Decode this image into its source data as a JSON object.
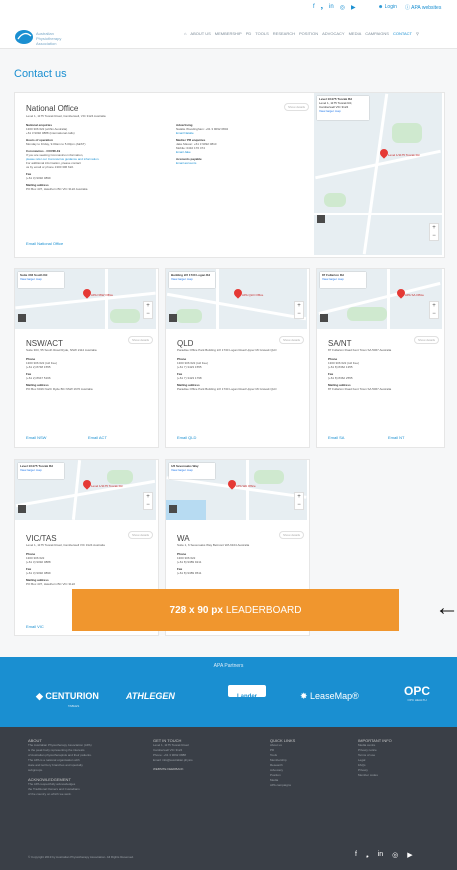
{
  "topbar": {
    "social": [
      "f",
      "❟",
      "in",
      "◎",
      "▶"
    ],
    "login": "Login",
    "apa_websites": "APA websites"
  },
  "logo": {
    "line1": "Australian",
    "line2": "Physiotherapy",
    "line3": "Association"
  },
  "nav": {
    "items": [
      "ABOUT US",
      "MEMBERSHIP",
      "PD",
      "TOOLS",
      "RESEARCH",
      "POSITION",
      "ADVOCACY",
      "MEDIA",
      "CAMPAIGNS",
      "CONTACT"
    ],
    "search_icon": "search-icon"
  },
  "page": {
    "title": "Contact us"
  },
  "national": {
    "title": "National Office",
    "address": "Level 1, 1175 Toorak Road, Camberwell, VIC 3124 Australia",
    "show_more": "Show details",
    "left": {
      "national_enquiries_label": "National enquiries",
      "national_enquiries": [
        "1300 306 622 (within Australia)",
        "+61 3 9092 0888 (international calls)"
      ],
      "hours_label": "Hours of operation",
      "hours": "Monday to Friday, 9.00am to 5.00pm (AEST)",
      "coronavirus_label": "Coronavirus - COVID-19",
      "coronavirus": [
        "If you are seeking Coronavirus information,",
        "please refer our Coronavirus guidance and information.",
        "For additional information, please contact",
        "us by email or phone 1300 306 622."
      ],
      "fax_label": "Fax",
      "fax": "(+61 3) 9092 0899",
      "mailing_label": "Mailing address",
      "mailing": "PO Box 437, Hawthorn BC VIC 3122 Australia"
    },
    "right": {
      "advertising_label": "Advertising",
      "advertising": [
        "Natalie Woodingham: +61 3 9092 0804",
        "Email Natalie"
      ],
      "media_label": "Media / PR enquiries",
      "media": [
        "Jake Mason: +61 3 9092 0810",
        "Mobile: 0410 176 474",
        "Email Jake"
      ],
      "accounts_label": "Accounts payable",
      "accounts": "Email accounts"
    },
    "email_link": "Email National Office",
    "map": {
      "info_title": "Level 1/1175 Toorak Rd",
      "info_sub": "Level 1, 1175 Toorak Rd, Camberwell VIC 3124",
      "info_link": "View larger map",
      "pin_label": "Level 1/1175 Toorak Rd"
    }
  },
  "branches": [
    {
      "title": "NSW/ACT",
      "address": "Suite 303, 55 South Road Ryde, NSW 2112 Australia",
      "phone_label": "Phone",
      "phone": [
        "1300 306 622 (toll free)",
        "(+61 2) 8748 1555"
      ],
      "fax_label": "Fax",
      "fax": "(+61 2) 8647 5166",
      "mailing_label": "Mailing address",
      "mailing": "PO Box 6016 North Ryde BC NSW 1670 Australia",
      "email_a": "Email NSW",
      "email_b": "Email ACT",
      "show_more": "Show details",
      "map": {
        "info_title": "Suite 303 South Rd",
        "info_link": "View larger map",
        "pin_label": "APA NSW Office"
      }
    },
    {
      "title": "QLD",
      "address": "Paradise Office Park Building 2/2 1730 Logan Road Upper Mt Gravatt QLD",
      "phone_label": "Phone",
      "phone": [
        "1300 306 622 (toll free)",
        "(+61 7) 3423 1555"
      ],
      "fax_label": "Fax",
      "fax": "(+61 7) 3423 1798",
      "mailing_label": "Mailing address",
      "mailing": "Paradise Office Park Building 2/2 1730 Logan Road Upper Mt Gravatt QLD",
      "email_a": "Email QLD",
      "email_b": "",
      "show_more": "Show details",
      "map": {
        "info_title": "Building 2/2 1730 Logan Rd",
        "info_link": "View larger map",
        "pin_label": "APA QLD Office"
      }
    },
    {
      "title": "SA/NT",
      "address": "87 Fullarton Road Kent Town SA 5067 Australia",
      "phone_label": "Phone",
      "phone": [
        "1300 306 622 (toll free)",
        "(+61 8) 8362 1355"
      ],
      "fax_label": "Fax",
      "fax": "(+61 8) 8362 2555",
      "mailing_label": "Mailing address",
      "mailing": "87 Fullarton Road Kent Town SA 5067 Australia",
      "email_a": "Email SA",
      "email_b": "Email NT",
      "show_more": "Show details",
      "map": {
        "info_title": "87 Fullarton Rd",
        "info_link": "View larger map",
        "pin_label": "APA SA Office"
      }
    },
    {
      "title": "VIC/TAS",
      "address": "Level 1, 1175 Toorak Road, Camberwell VIC 3124 Australia",
      "phone_label": "Phone",
      "phone": [
        "1300 306 622",
        "(+61 3) 9092 0888"
      ],
      "fax_label": "Fax",
      "fax": "(+61 3) 9092 0899",
      "mailing_label": "Mailing address",
      "mailing": "PO Box 437, Hawthorn BC VIC 3122",
      "email_a": "Email VIC",
      "email_b": "",
      "show_more": "Show details",
      "map": {
        "info_title": "Level 1/1175 Toorak Rd",
        "info_link": "View larger map",
        "pin_label": "Level 1/1175 Toorak Rd"
      }
    },
    {
      "title": "WA",
      "address": "Suite 1, 6 Sevenoaks Way Belmont WA 6104 Australia",
      "phone_label": "Phone",
      "phone": [
        "1300 306 622",
        "(+61 8) 9389 9211"
      ],
      "fax_label": "Fax",
      "fax": "(+61 8) 9389 9511",
      "mailing_label": "",
      "mailing": "",
      "email_a": "",
      "email_b": "",
      "show_more": "Show details",
      "map": {
        "info_title": "1/6 Sevenoaks Way",
        "info_link": "View larger map",
        "pin_label": "APA WA Office"
      }
    }
  ],
  "leaderboard": {
    "size": "728 x 90 px",
    "label": "LEADERBOARD"
  },
  "arrow": "←",
  "partners": {
    "title": "APA Partners",
    "items": [
      "CENTURION",
      "ATHLEGEN",
      "Lander",
      "LeaseMap®",
      "OPC"
    ],
    "subs": [
      "TABLES",
      "",
      "",
      "",
      "OPC HEALTH"
    ]
  },
  "footer": {
    "about_title": "ABOUT",
    "about": [
      "The Australian Physiotherapy Association (APA)",
      "is the peak body representing the interests",
      "of Australian physiotherapists and their patients.",
      "The APA is a national organisation with",
      "state and territory branches and specialty",
      "subgroups."
    ],
    "ack_title": "ACKNOWLEDGEMENT",
    "ack": [
      "The APA respectfully acknowledges",
      "the Traditional Owners and Custodians",
      "of the country on which we work."
    ],
    "contact_title": "GET IN TOUCH",
    "contact": [
      "Level 1, 1175 Toorak Road",
      "Camberwell VIC 3124",
      "Phone: +61 3 9092 0888",
      "Email: info@australian.physio"
    ],
    "website": "WEBSITE FEEDBACK",
    "quick_title": "QUICK LINKS",
    "quick": [
      "About us",
      "PD",
      "Tools",
      "Membership",
      "Research",
      "Advocacy",
      "Position",
      "Media",
      "APA campaigns"
    ],
    "important_title": "IMPORTANT INFO",
    "important": [
      "Media centre",
      "Privacy notice",
      "Terms of use",
      "Legal",
      "FAQs",
      "Privacy",
      "Member codes"
    ],
    "copyright": "© Copyright 2019 by Australian Physiotherapy Association. All Rights Reserved.",
    "social": [
      "f",
      "❟",
      "in",
      "◎",
      "▶"
    ]
  }
}
